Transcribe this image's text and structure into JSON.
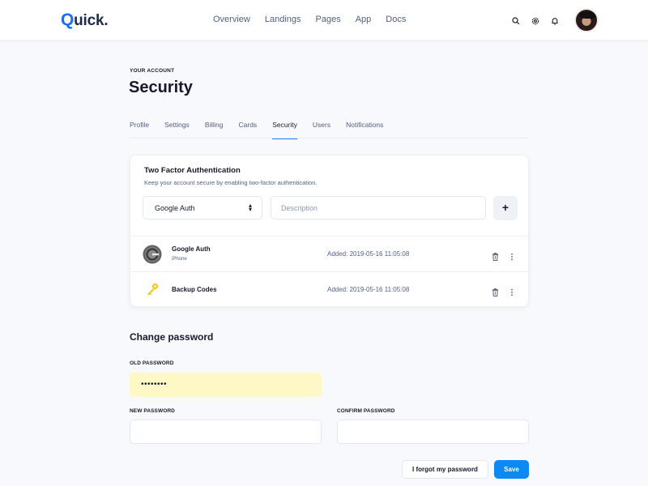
{
  "brand": {
    "logo_q": "Q",
    "logo_rest": "uick."
  },
  "nav": [
    {
      "label": "Overview"
    },
    {
      "label": "Landings"
    },
    {
      "label": "Pages"
    },
    {
      "label": "App"
    },
    {
      "label": "Docs"
    }
  ],
  "header_icons": [
    "search-icon",
    "gear-icon",
    "bell-icon"
  ],
  "page": {
    "eyebrow": "YOUR ACCOUNT",
    "title": "Security"
  },
  "tabs": [
    {
      "label": "Profile",
      "active": false
    },
    {
      "label": "Settings",
      "active": false
    },
    {
      "label": "Billing",
      "active": false
    },
    {
      "label": "Cards",
      "active": false
    },
    {
      "label": "Security",
      "active": true
    },
    {
      "label": "Users",
      "active": false
    },
    {
      "label": "Notifications",
      "active": false
    }
  ],
  "two_factor": {
    "title": "Two Factor Authentication",
    "subtitle": "Keep your account secure by enabling two-factor authentication.",
    "method_select": {
      "value": "Google Auth"
    },
    "description_input": {
      "value": "",
      "placeholder": "Description"
    },
    "add_label": "+",
    "methods": [
      {
        "name": "Google Auth",
        "device": "iPhone",
        "added": "Added: 2019-05-16 11:05:08",
        "icon": "google-authenticator-icon"
      },
      {
        "name": "Backup Codes",
        "device": "",
        "added": "Added: 2019-05-16 11:05:08",
        "icon": "key-icon"
      }
    ]
  },
  "change_password": {
    "title": "Change password",
    "old_label": "OLD PASSWORD",
    "old_value": "••••••••",
    "new_label": "NEW PASSWORD",
    "new_value": "",
    "confirm_label": "CONFIRM PASSWORD",
    "confirm_value": "",
    "forgot_label": "I forgot my password",
    "save_label": "Save"
  },
  "colors": {
    "accent": "#0c89f3",
    "autofill": "#fdf8c6",
    "text": "#16192c",
    "muted": "#525f7f"
  }
}
